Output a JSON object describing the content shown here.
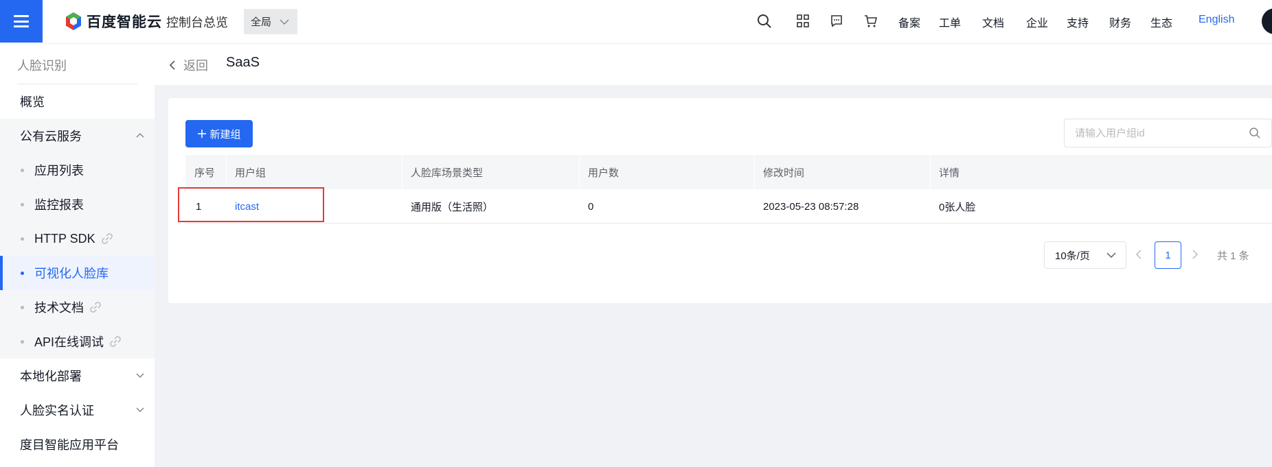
{
  "header": {
    "brand": "百度智能云",
    "console_title": "控制台总览",
    "region": "全局",
    "nav_links": [
      "备案",
      "工单",
      "文档",
      "企业",
      "支持",
      "财务",
      "生态"
    ],
    "language": "English"
  },
  "sidebar": {
    "title": "人脸识别",
    "overview": "概览",
    "public_cloud": "公有云服务",
    "sub_items": [
      "应用列表",
      "监控报表",
      "HTTP SDK",
      "可视化人脸库",
      "技术文档",
      "API在线调试"
    ],
    "local_deploy": "本地化部署",
    "realname": "人脸实名认证",
    "platform": "度目智能应用平台"
  },
  "breadcrumb": {
    "back": "返回",
    "title": "SaaS"
  },
  "toolbar": {
    "new_group": "新建组",
    "search_placeholder": "请输入用户组id"
  },
  "table": {
    "columns": [
      "序号",
      "用户组",
      "人脸库场景类型",
      "用户数",
      "修改时间",
      "详情"
    ],
    "rows": [
      [
        "1",
        "itcast",
        "通用版（生活照）",
        "0",
        "2023-05-23 08:57:28",
        "0张人脸"
      ]
    ]
  },
  "pagination": {
    "page_size": "10条/页",
    "current_page": "1",
    "total": "共 1 条"
  },
  "colors": {
    "accent": "#2468f2",
    "highlight": "#e53935"
  },
  "icons": [
    "menu-icon",
    "brand-logo-icon",
    "search-icon",
    "apps-icon",
    "message-icon",
    "cart-icon",
    "chevron-up-icon",
    "chevron-down-icon",
    "link-icon",
    "back-arrow-icon",
    "plus-icon"
  ]
}
